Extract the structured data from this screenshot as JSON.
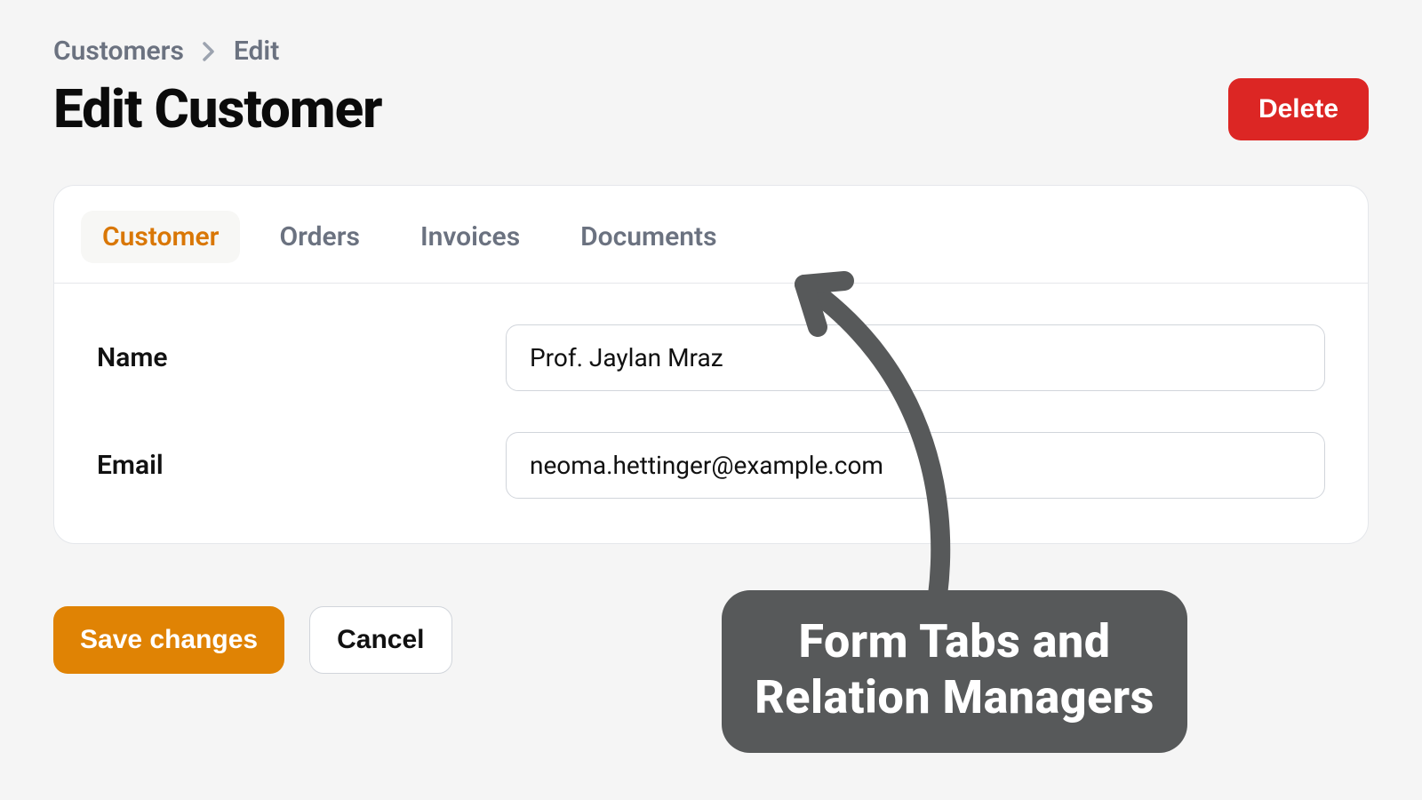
{
  "breadcrumbs": {
    "root": "Customers",
    "current": "Edit"
  },
  "header": {
    "title": "Edit Customer",
    "delete_label": "Delete"
  },
  "tabs": [
    {
      "label": "Customer",
      "active": true
    },
    {
      "label": "Orders",
      "active": false
    },
    {
      "label": "Invoices",
      "active": false
    },
    {
      "label": "Documents",
      "active": false
    }
  ],
  "form": {
    "name_label": "Name",
    "name_value": "Prof. Jaylan Mraz",
    "email_label": "Email",
    "email_value": "neoma.hettinger@example.com"
  },
  "actions": {
    "save_label": "Save changes",
    "cancel_label": "Cancel"
  },
  "annotation": {
    "line1": "Form Tabs and",
    "line2": "Relation Managers"
  },
  "colors": {
    "accent": "#d97706",
    "danger": "#dc2624",
    "primary": "#e08304",
    "callout_bg": "#57595a"
  }
}
